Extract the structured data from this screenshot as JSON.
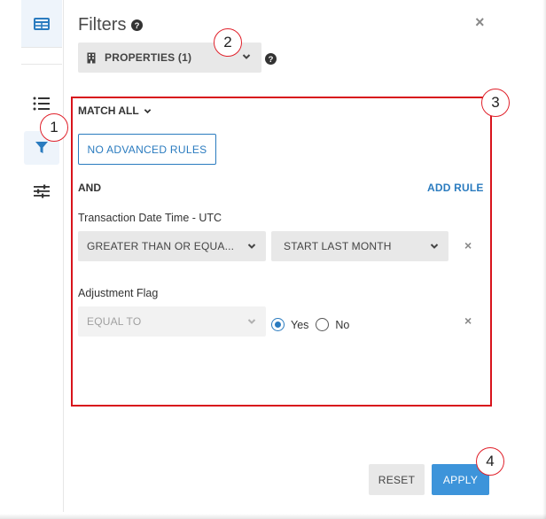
{
  "header": {
    "title": "Filters",
    "close_symbol": "×",
    "properties_label": "PROPERTIES (1)"
  },
  "annotations": [
    "1",
    "2",
    "3",
    "4"
  ],
  "rules": {
    "match_label": "MATCH ALL",
    "no_advanced_rules_label": "NO ADVANCED RULES",
    "and_label": "AND",
    "add_rule_label": "ADD RULE",
    "items": [
      {
        "field_label": "Transaction Date Time - UTC",
        "operator": "GREATER THAN OR EQUA...",
        "value": "START LAST MONTH",
        "remove_symbol": "×"
      },
      {
        "field_label": "Adjustment Flag",
        "operator": "EQUAL TO",
        "options": [
          "Yes",
          "No"
        ],
        "selected": "Yes",
        "remove_symbol": "×"
      }
    ]
  },
  "footer": {
    "reset_label": "RESET",
    "apply_label": "APPLY"
  },
  "colors": {
    "accent": "#2a7bbf",
    "apply": "#3d94da",
    "annotation_red": "#d8131c"
  },
  "icons": {
    "rail": [
      "table-icon",
      "list-icon",
      "filter-icon",
      "sliders-icon"
    ],
    "header": [
      "help-icon",
      "building-icon",
      "chevron-down-icon",
      "close-icon"
    ]
  }
}
